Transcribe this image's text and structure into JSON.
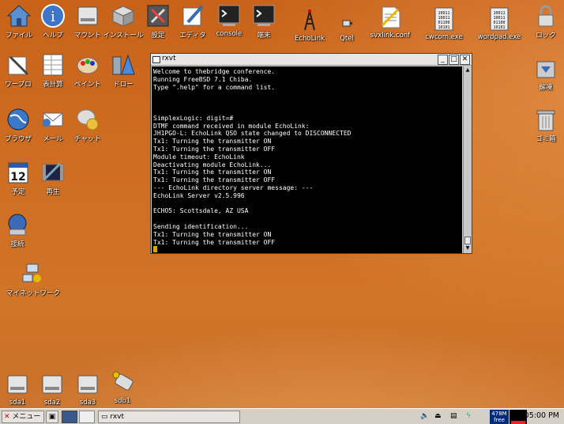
{
  "desktop": {
    "top_row": [
      {
        "label": "ファイル",
        "icon": "home-icon"
      },
      {
        "label": "ヘルプ",
        "icon": "help-icon"
      },
      {
        "label": "マウント",
        "icon": "drive-icon"
      },
      {
        "label": "インストール",
        "icon": "package-icon"
      },
      {
        "label": "設定",
        "icon": "settings-icon"
      },
      {
        "label": "エディタ",
        "icon": "editor-icon"
      },
      {
        "label": "console",
        "icon": "console-icon"
      },
      {
        "label": "端末",
        "icon": "terminal-icon"
      },
      {
        "label": "EchoLink",
        "icon": "echolink-icon"
      },
      {
        "label": "Qtel",
        "icon": "qtel-icon"
      },
      {
        "label": "svxlink.conf",
        "icon": "config-file-icon"
      },
      {
        "label": "cwcom.exe",
        "icon": "binary-file-icon"
      },
      {
        "label": "wordpad.exe",
        "icon": "binary-file-icon"
      },
      {
        "label": "ロック",
        "icon": "lock-icon"
      }
    ],
    "left_col": [
      {
        "label": "ワープロ",
        "icon": "wordprocessor-icon"
      },
      {
        "label": "表計算",
        "icon": "spreadsheet-icon"
      },
      {
        "label": "ペイント",
        "icon": "paint-icon"
      },
      {
        "label": "ドロー",
        "icon": "draw-icon"
      },
      {
        "label": "ブラウザ",
        "icon": "browser-icon"
      },
      {
        "label": "メール",
        "icon": "mail-icon"
      },
      {
        "label": "チャット",
        "icon": "chat-icon"
      },
      {
        "label": "予定",
        "icon": "calendar-icon"
      },
      {
        "label": "再生",
        "icon": "media-player-icon"
      },
      {
        "label": "接続",
        "icon": "connect-icon"
      },
      {
        "label": "マイネットワーク",
        "icon": "network-icon"
      }
    ],
    "right_col": [
      {
        "label": "解凍",
        "icon": "extract-icon"
      },
      {
        "label": "ゴミ箱",
        "icon": "trash-icon"
      }
    ],
    "calendar_day": "12",
    "drives": [
      {
        "label": "sda1",
        "icon": "drive-icon"
      },
      {
        "label": "sda2",
        "icon": "drive-icon"
      },
      {
        "label": "sda3",
        "icon": "drive-icon"
      },
      {
        "label": "sdb1",
        "icon": "usb-drive-icon"
      }
    ]
  },
  "window": {
    "title": "rxvt",
    "lines": [
      "Welcome to thebridge conference.",
      "Running FreeBSD 7.1 Chiba.",
      "Type \".help\" for a command list.",
      "",
      "",
      "",
      "SimplexLogic: digit=#",
      "DTMF command received in module EchoLink:",
      "JH1PGO-L: EchoLink QSO state changed to DISCONNECTED",
      "Tx1: Turning the transmitter ON",
      "Tx1: Turning the transmitter OFF",
      "Module timeout: EchoLink",
      "Deactivating module EchoLink...",
      "Tx1: Turning the transmitter ON",
      "Tx1: Turning the transmitter OFF",
      "--- EchoLink directory server message: ---",
      "EchoLink Server v2.5.996",
      "",
      "ECHO5: Scottsdale, AZ USA",
      "",
      "Sending identification...",
      "Tx1: Turning the transmitter ON",
      "Tx1: Turning the transmitter OFF"
    ]
  },
  "taskbar": {
    "menu_label": "メニュー",
    "task_label": "rxvt",
    "mem_value": "478M",
    "mem_label": "free",
    "clock": "05:00 PM"
  }
}
